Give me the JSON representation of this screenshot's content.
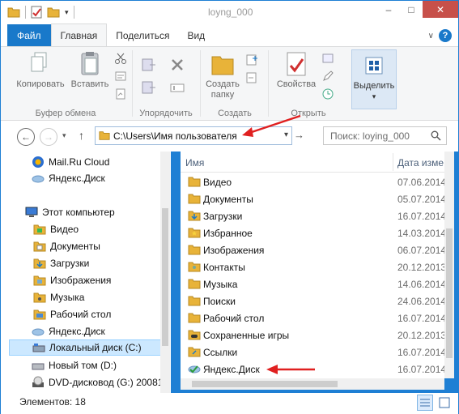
{
  "window": {
    "title": "loyng_000",
    "min_icon": "minimize-icon",
    "max_icon": "maximize-icon",
    "close_label": "✕"
  },
  "ribbon_tabs": {
    "file": "Файл",
    "home": "Главная",
    "share": "Поделиться",
    "view": "Вид"
  },
  "ribbon": {
    "copy": "Копировать",
    "paste": "Вставить",
    "clipboard_group": "Буфер обмена",
    "organize_group": "Упорядочить",
    "new_folder": "Создать\nпапку",
    "new_folder_l1": "Создать",
    "new_folder_l2": "папку",
    "new_group": "Создать",
    "properties": "Свойства",
    "open_group": "Открыть",
    "select": "Выделить"
  },
  "address": {
    "path": "C:\\Users\\Имя пользователя",
    "search_placeholder": "Поиск: loying_000"
  },
  "nav_pane": {
    "items": [
      {
        "label": "Mail.Ru Cloud",
        "icon": "mailru-cloud-icon"
      },
      {
        "label": "Яндекс.Диск",
        "icon": "yandex-disk-icon"
      },
      {
        "label": "Этот компьютер",
        "icon": "computer-icon"
      },
      {
        "label": "Видео",
        "icon": "folder-icon"
      },
      {
        "label": "Документы",
        "icon": "folder-icon"
      },
      {
        "label": "Загрузки",
        "icon": "folder-icon"
      },
      {
        "label": "Изображения",
        "icon": "folder-icon"
      },
      {
        "label": "Музыка",
        "icon": "folder-icon"
      },
      {
        "label": "Рабочий стол",
        "icon": "folder-icon"
      },
      {
        "label": "Яндекс.Диск",
        "icon": "yandex-disk-icon"
      },
      {
        "label": "Локальный диск (C:)",
        "icon": "drive-icon"
      },
      {
        "label": "Новый том (D:)",
        "icon": "drive-icon"
      },
      {
        "label": "DVD-дисковод (G:) 20081",
        "icon": "dvd-icon"
      }
    ]
  },
  "file_list": {
    "col_name": "Имя",
    "col_date": "Дата изме",
    "rows": [
      {
        "name": "Видео",
        "date": "07.06.2014"
      },
      {
        "name": "Документы",
        "date": "05.07.2014"
      },
      {
        "name": "Загрузки",
        "date": "16.07.2014"
      },
      {
        "name": "Избранное",
        "date": "14.03.2014"
      },
      {
        "name": "Изображения",
        "date": "06.07.2014"
      },
      {
        "name": "Контакты",
        "date": "20.12.2013"
      },
      {
        "name": "Музыка",
        "date": "14.06.2014"
      },
      {
        "name": "Поиски",
        "date": "24.06.2014"
      },
      {
        "name": "Рабочий стол",
        "date": "16.07.2014"
      },
      {
        "name": "Сохраненные игры",
        "date": "20.12.2013"
      },
      {
        "name": "Ссылки",
        "date": "16.07.2014"
      },
      {
        "name": "Яндекс.Диск",
        "date": "16.07.2014"
      }
    ]
  },
  "status": {
    "items_text": "Элементов: 18"
  },
  "colors": {
    "accent": "#1979ca",
    "annotation_arrow": "#e02020",
    "folder": "#e8b339"
  }
}
